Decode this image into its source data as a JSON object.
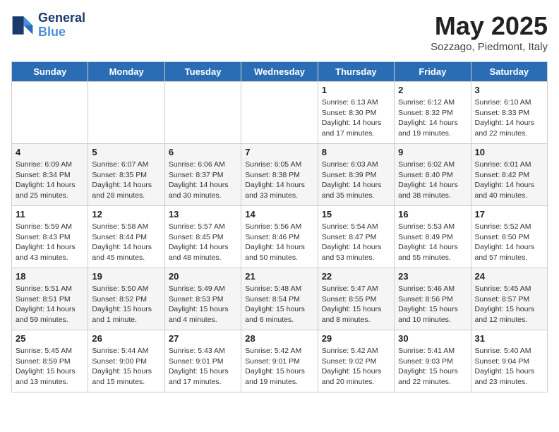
{
  "header": {
    "logo_line1": "General",
    "logo_line2": "Blue",
    "month": "May 2025",
    "location": "Sozzago, Piedmont, Italy"
  },
  "days_of_week": [
    "Sunday",
    "Monday",
    "Tuesday",
    "Wednesday",
    "Thursday",
    "Friday",
    "Saturday"
  ],
  "weeks": [
    [
      {
        "day": "",
        "info": ""
      },
      {
        "day": "",
        "info": ""
      },
      {
        "day": "",
        "info": ""
      },
      {
        "day": "",
        "info": ""
      },
      {
        "day": "1",
        "info": "Sunrise: 6:13 AM\nSunset: 8:30 PM\nDaylight: 14 hours and 17 minutes."
      },
      {
        "day": "2",
        "info": "Sunrise: 6:12 AM\nSunset: 8:32 PM\nDaylight: 14 hours and 19 minutes."
      },
      {
        "day": "3",
        "info": "Sunrise: 6:10 AM\nSunset: 8:33 PM\nDaylight: 14 hours and 22 minutes."
      }
    ],
    [
      {
        "day": "4",
        "info": "Sunrise: 6:09 AM\nSunset: 8:34 PM\nDaylight: 14 hours and 25 minutes."
      },
      {
        "day": "5",
        "info": "Sunrise: 6:07 AM\nSunset: 8:35 PM\nDaylight: 14 hours and 28 minutes."
      },
      {
        "day": "6",
        "info": "Sunrise: 6:06 AM\nSunset: 8:37 PM\nDaylight: 14 hours and 30 minutes."
      },
      {
        "day": "7",
        "info": "Sunrise: 6:05 AM\nSunset: 8:38 PM\nDaylight: 14 hours and 33 minutes."
      },
      {
        "day": "8",
        "info": "Sunrise: 6:03 AM\nSunset: 8:39 PM\nDaylight: 14 hours and 35 minutes."
      },
      {
        "day": "9",
        "info": "Sunrise: 6:02 AM\nSunset: 8:40 PM\nDaylight: 14 hours and 38 minutes."
      },
      {
        "day": "10",
        "info": "Sunrise: 6:01 AM\nSunset: 8:42 PM\nDaylight: 14 hours and 40 minutes."
      }
    ],
    [
      {
        "day": "11",
        "info": "Sunrise: 5:59 AM\nSunset: 8:43 PM\nDaylight: 14 hours and 43 minutes."
      },
      {
        "day": "12",
        "info": "Sunrise: 5:58 AM\nSunset: 8:44 PM\nDaylight: 14 hours and 45 minutes."
      },
      {
        "day": "13",
        "info": "Sunrise: 5:57 AM\nSunset: 8:45 PM\nDaylight: 14 hours and 48 minutes."
      },
      {
        "day": "14",
        "info": "Sunrise: 5:56 AM\nSunset: 8:46 PM\nDaylight: 14 hours and 50 minutes."
      },
      {
        "day": "15",
        "info": "Sunrise: 5:54 AM\nSunset: 8:47 PM\nDaylight: 14 hours and 53 minutes."
      },
      {
        "day": "16",
        "info": "Sunrise: 5:53 AM\nSunset: 8:49 PM\nDaylight: 14 hours and 55 minutes."
      },
      {
        "day": "17",
        "info": "Sunrise: 5:52 AM\nSunset: 8:50 PM\nDaylight: 14 hours and 57 minutes."
      }
    ],
    [
      {
        "day": "18",
        "info": "Sunrise: 5:51 AM\nSunset: 8:51 PM\nDaylight: 14 hours and 59 minutes."
      },
      {
        "day": "19",
        "info": "Sunrise: 5:50 AM\nSunset: 8:52 PM\nDaylight: 15 hours and 1 minute."
      },
      {
        "day": "20",
        "info": "Sunrise: 5:49 AM\nSunset: 8:53 PM\nDaylight: 15 hours and 4 minutes."
      },
      {
        "day": "21",
        "info": "Sunrise: 5:48 AM\nSunset: 8:54 PM\nDaylight: 15 hours and 6 minutes."
      },
      {
        "day": "22",
        "info": "Sunrise: 5:47 AM\nSunset: 8:55 PM\nDaylight: 15 hours and 8 minutes."
      },
      {
        "day": "23",
        "info": "Sunrise: 5:46 AM\nSunset: 8:56 PM\nDaylight: 15 hours and 10 minutes."
      },
      {
        "day": "24",
        "info": "Sunrise: 5:45 AM\nSunset: 8:57 PM\nDaylight: 15 hours and 12 minutes."
      }
    ],
    [
      {
        "day": "25",
        "info": "Sunrise: 5:45 AM\nSunset: 8:59 PM\nDaylight: 15 hours and 13 minutes."
      },
      {
        "day": "26",
        "info": "Sunrise: 5:44 AM\nSunset: 9:00 PM\nDaylight: 15 hours and 15 minutes."
      },
      {
        "day": "27",
        "info": "Sunrise: 5:43 AM\nSunset: 9:01 PM\nDaylight: 15 hours and 17 minutes."
      },
      {
        "day": "28",
        "info": "Sunrise: 5:42 AM\nSunset: 9:01 PM\nDaylight: 15 hours and 19 minutes."
      },
      {
        "day": "29",
        "info": "Sunrise: 5:42 AM\nSunset: 9:02 PM\nDaylight: 15 hours and 20 minutes."
      },
      {
        "day": "30",
        "info": "Sunrise: 5:41 AM\nSunset: 9:03 PM\nDaylight: 15 hours and 22 minutes."
      },
      {
        "day": "31",
        "info": "Sunrise: 5:40 AM\nSunset: 9:04 PM\nDaylight: 15 hours and 23 minutes."
      }
    ]
  ]
}
